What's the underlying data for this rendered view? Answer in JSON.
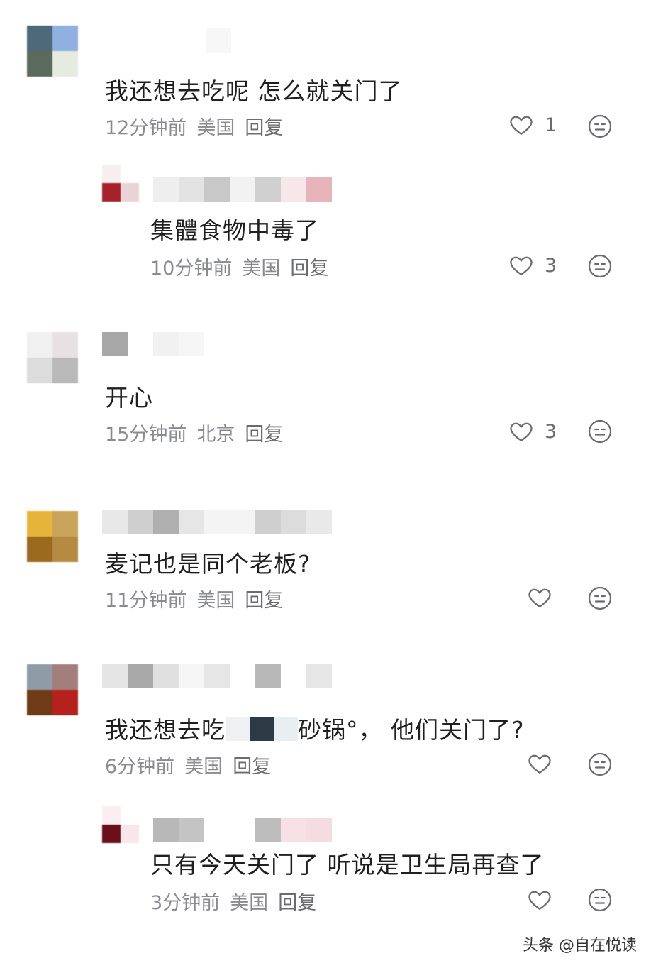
{
  "comments": [
    {
      "text": "我还想去吃呢 怎么就关门了",
      "time": "12分钟前",
      "location": "美国",
      "reply": "回复",
      "likes": "1",
      "avatar_colors": [
        "#4e6a7a",
        "#8fb0e0",
        "#5a6b5e",
        "#c9d3b8"
      ],
      "mosaic_colors": [
        "#ffffff",
        "#f3f3f3"
      ]
    },
    {
      "text": "集體食物中毒了",
      "time": "10分钟前",
      "location": "美国",
      "reply": "回复",
      "likes": "3",
      "avatar_colors": [
        "#f2e6e8",
        "#ffffff",
        "#a5222b",
        "#e8d3d6"
      ],
      "mosaic_colors": [
        "#eeeeee",
        "#e3e3e3",
        "#c8c8c8",
        "#f2f2f2",
        "#d0d0d0",
        "#f8e7ea",
        "#e8b4bc"
      ]
    },
    {
      "text": "开心",
      "time": "15分钟前",
      "location": "北京",
      "reply": "回复",
      "likes": "3",
      "avatar_colors": [
        "#f0f0f0",
        "#e7e1e3",
        "#dcdcdc",
        "#b9b9b9"
      ],
      "mosaic_colors": [
        "#a8a8a8",
        "#ffffff",
        "#f1f1f1",
        "#f6f6f6"
      ]
    },
    {
      "text": "麦记也是同个老板?",
      "time": "11分钟前",
      "location": "美国",
      "reply": "回复",
      "likes": "",
      "avatar_colors": [
        "#e6b43a",
        "#c9a45a",
        "#9b6a1e",
        "#b58a42"
      ],
      "mosaic_colors": [
        "#e8e8e8",
        "#cfcfcf",
        "#b0b0b0",
        "#e6e6e6",
        "#f4f4f4",
        "#cfcfcf",
        "#dcdcdc",
        "#e9e9e9"
      ]
    },
    {
      "text_before": "我还想去吃",
      "text_after": "砂锅°， 他们关门了?",
      "time": "6分钟前",
      "location": "美国",
      "reply": "回复",
      "likes": "",
      "avatar_colors": [
        "#8f9ba5",
        "#a37f7c",
        "#6f3a16",
        "#b5211c"
      ],
      "mosaic_colors": [
        "#e5e5e5",
        "#a9a9a9",
        "#e0e0e0",
        "#f5f5f5",
        "#e6e6e6",
        "#ffffff",
        "#b8b8b8",
        "#ffffff",
        "#e6e6e6"
      ],
      "inline_blur_colors": [
        "#eef0f2",
        "#2b3a44",
        "#e8eef2"
      ]
    },
    {
      "text": "只有今天关门了 听说是卫生局再查了",
      "time": "3分钟前",
      "location": "美国",
      "reply": "回复",
      "likes": "",
      "avatar_colors": [
        "#fbeef0",
        "#ffffff",
        "#6b0f18",
        "#f7e6ea"
      ],
      "mosaic_colors": [
        "#ffffff",
        "#b8b8b8",
        "#c4c4c4",
        "#ffffff",
        "#ffffff",
        "#bdbdbd",
        "#f8e1e6",
        "#f5dce3"
      ]
    }
  ],
  "watermark": "头条 @自在悦读"
}
